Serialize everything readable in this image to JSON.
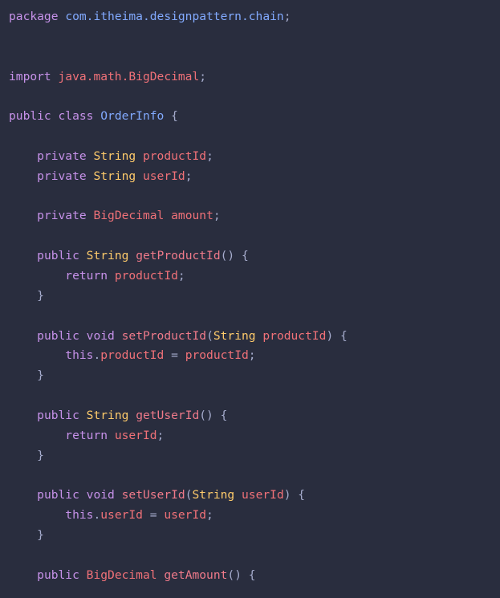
{
  "editor": {
    "theme": {
      "background": "#292d3e",
      "keyword": "#c792ea",
      "type": "#ffcb6b",
      "function": "#ef7a8a",
      "variable": "#f07178",
      "package": "#82aaff",
      "class_name": "#82aaff",
      "punctuation": "#a6accd"
    },
    "lines": [
      [
        {
          "t": "package",
          "c": "kw"
        },
        {
          "t": " ",
          "c": "pl"
        },
        {
          "t": "com.itheima.designpattern.chain",
          "c": "pk"
        },
        {
          "t": ";",
          "c": "pu"
        }
      ],
      [],
      [],
      [
        {
          "t": "import",
          "c": "kw"
        },
        {
          "t": " ",
          "c": "pl"
        },
        {
          "t": "java.math.",
          "c": "var"
        },
        {
          "t": "BigDecimal",
          "c": "var"
        },
        {
          "t": ";",
          "c": "pu"
        }
      ],
      [],
      [
        {
          "t": "public",
          "c": "kw"
        },
        {
          "t": " ",
          "c": "pl"
        },
        {
          "t": "class",
          "c": "kw"
        },
        {
          "t": " ",
          "c": "pl"
        },
        {
          "t": "OrderInfo",
          "c": "cls"
        },
        {
          "t": " {",
          "c": "pu"
        }
      ],
      [],
      [
        {
          "t": "    ",
          "c": "pl"
        },
        {
          "t": "private",
          "c": "kw"
        },
        {
          "t": " ",
          "c": "pl"
        },
        {
          "t": "String",
          "c": "ty"
        },
        {
          "t": " ",
          "c": "pl"
        },
        {
          "t": "productId",
          "c": "var"
        },
        {
          "t": ";",
          "c": "pu"
        }
      ],
      [
        {
          "t": "    ",
          "c": "pl"
        },
        {
          "t": "private",
          "c": "kw"
        },
        {
          "t": " ",
          "c": "pl"
        },
        {
          "t": "String",
          "c": "ty"
        },
        {
          "t": " ",
          "c": "pl"
        },
        {
          "t": "userId",
          "c": "var"
        },
        {
          "t": ";",
          "c": "pu"
        }
      ],
      [],
      [
        {
          "t": "    ",
          "c": "pl"
        },
        {
          "t": "private",
          "c": "kw"
        },
        {
          "t": " ",
          "c": "pl"
        },
        {
          "t": "BigDecimal",
          "c": "var"
        },
        {
          "t": " ",
          "c": "pl"
        },
        {
          "t": "amount",
          "c": "var"
        },
        {
          "t": ";",
          "c": "pu"
        }
      ],
      [],
      [
        {
          "t": "    ",
          "c": "pl"
        },
        {
          "t": "public",
          "c": "kw"
        },
        {
          "t": " ",
          "c": "pl"
        },
        {
          "t": "String",
          "c": "ty"
        },
        {
          "t": " ",
          "c": "pl"
        },
        {
          "t": "getProductId",
          "c": "fn"
        },
        {
          "t": "() {",
          "c": "pu"
        }
      ],
      [
        {
          "t": "        ",
          "c": "pl"
        },
        {
          "t": "return",
          "c": "kw"
        },
        {
          "t": " ",
          "c": "pl"
        },
        {
          "t": "productId",
          "c": "var"
        },
        {
          "t": ";",
          "c": "pu"
        }
      ],
      [
        {
          "t": "    ",
          "c": "pl"
        },
        {
          "t": "}",
          "c": "pu"
        }
      ],
      [],
      [
        {
          "t": "    ",
          "c": "pl"
        },
        {
          "t": "public",
          "c": "kw"
        },
        {
          "t": " ",
          "c": "pl"
        },
        {
          "t": "void",
          "c": "kw"
        },
        {
          "t": " ",
          "c": "pl"
        },
        {
          "t": "setProductId",
          "c": "fn"
        },
        {
          "t": "(",
          "c": "pu"
        },
        {
          "t": "String",
          "c": "ty"
        },
        {
          "t": " ",
          "c": "pl"
        },
        {
          "t": "productId",
          "c": "var"
        },
        {
          "t": ") {",
          "c": "pu"
        }
      ],
      [
        {
          "t": "        ",
          "c": "pl"
        },
        {
          "t": "this",
          "c": "kw"
        },
        {
          "t": ".",
          "c": "pu"
        },
        {
          "t": "productId",
          "c": "var"
        },
        {
          "t": " = ",
          "c": "pu"
        },
        {
          "t": "productId",
          "c": "var"
        },
        {
          "t": ";",
          "c": "pu"
        }
      ],
      [
        {
          "t": "    ",
          "c": "pl"
        },
        {
          "t": "}",
          "c": "pu"
        }
      ],
      [],
      [
        {
          "t": "    ",
          "c": "pl"
        },
        {
          "t": "public",
          "c": "kw"
        },
        {
          "t": " ",
          "c": "pl"
        },
        {
          "t": "String",
          "c": "ty"
        },
        {
          "t": " ",
          "c": "pl"
        },
        {
          "t": "getUserId",
          "c": "fn"
        },
        {
          "t": "() {",
          "c": "pu"
        }
      ],
      [
        {
          "t": "        ",
          "c": "pl"
        },
        {
          "t": "return",
          "c": "kw"
        },
        {
          "t": " ",
          "c": "pl"
        },
        {
          "t": "userId",
          "c": "var"
        },
        {
          "t": ";",
          "c": "pu"
        }
      ],
      [
        {
          "t": "    ",
          "c": "pl"
        },
        {
          "t": "}",
          "c": "pu"
        }
      ],
      [],
      [
        {
          "t": "    ",
          "c": "pl"
        },
        {
          "t": "public",
          "c": "kw"
        },
        {
          "t": " ",
          "c": "pl"
        },
        {
          "t": "void",
          "c": "kw"
        },
        {
          "t": " ",
          "c": "pl"
        },
        {
          "t": "setUserId",
          "c": "fn"
        },
        {
          "t": "(",
          "c": "pu"
        },
        {
          "t": "String",
          "c": "ty"
        },
        {
          "t": " ",
          "c": "pl"
        },
        {
          "t": "userId",
          "c": "var"
        },
        {
          "t": ") {",
          "c": "pu"
        }
      ],
      [
        {
          "t": "        ",
          "c": "pl"
        },
        {
          "t": "this",
          "c": "kw"
        },
        {
          "t": ".",
          "c": "pu"
        },
        {
          "t": "userId",
          "c": "var"
        },
        {
          "t": " = ",
          "c": "pu"
        },
        {
          "t": "userId",
          "c": "var"
        },
        {
          "t": ";",
          "c": "pu"
        }
      ],
      [
        {
          "t": "    ",
          "c": "pl"
        },
        {
          "t": "}",
          "c": "pu"
        }
      ],
      [],
      [
        {
          "t": "    ",
          "c": "pl"
        },
        {
          "t": "public",
          "c": "kw"
        },
        {
          "t": " ",
          "c": "pl"
        },
        {
          "t": "BigDecimal",
          "c": "var"
        },
        {
          "t": " ",
          "c": "pl"
        },
        {
          "t": "getAmount",
          "c": "fn"
        },
        {
          "t": "() {",
          "c": "pu"
        }
      ]
    ]
  }
}
